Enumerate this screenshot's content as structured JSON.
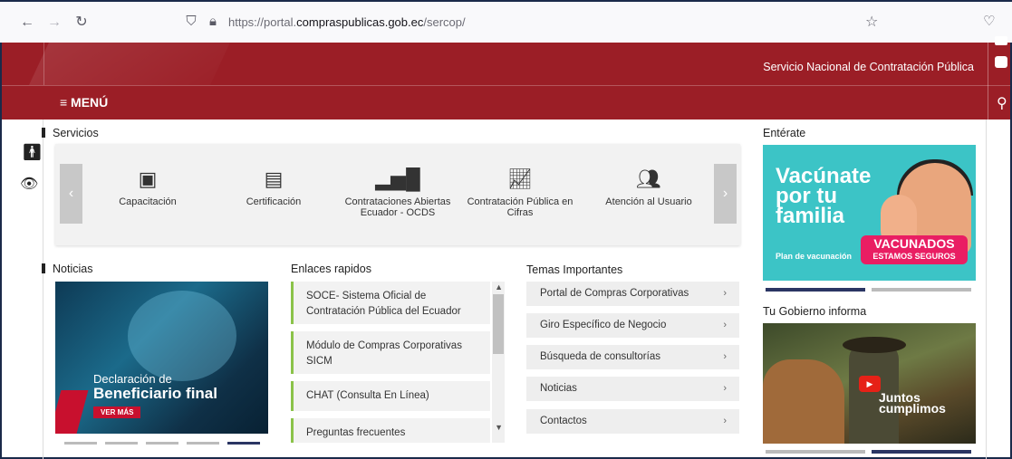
{
  "browser": {
    "url_prefix": "https://portal.",
    "url_domain": "compraspublicas.gob.ec",
    "url_path": "/sercop/"
  },
  "header": {
    "site_name": "Servicio Nacional de Contratación Pública",
    "menu_label": "≡ MENÚ"
  },
  "services": {
    "title": "Servicios",
    "items": [
      {
        "label": "Capacitación",
        "icon": "book-icon"
      },
      {
        "label": "Certificación",
        "icon": "certificate-icon"
      },
      {
        "label": "Contrataciones Abiertas Ecuador - OCDS",
        "icon": "bar-chart-icon"
      },
      {
        "label": "Contratación Pública en Cifras",
        "icon": "line-chart-icon"
      },
      {
        "label": "Atención al Usuario",
        "icon": "users-icon"
      }
    ]
  },
  "news": {
    "title": "Noticias",
    "slide_line1": "Declaración de",
    "slide_line2": "Beneficiario final",
    "slide_button": "VER MÁS"
  },
  "links": {
    "title": "Enlaces rapidos",
    "items": [
      "SOCE- Sistema Oficial de Contratación Pública del Ecuador",
      "Módulo de Compras Corporativas SICM",
      "CHAT (Consulta En Línea)",
      "Preguntas frecuentes"
    ]
  },
  "topics": {
    "title": "Temas Importantes",
    "items": [
      "Portal de Compras Corporativas",
      "Giro Específico de Negocio",
      "Búsqueda de consultorías",
      "Noticias",
      "Contactos"
    ]
  },
  "right": {
    "enterate_title": "Entérate",
    "banner_line1": "Vacúnate",
    "banner_line2": "por tu",
    "banner_line3": "familia",
    "banner_badge1": "VACUNADOS",
    "banner_badge2": "ESTAMOS SEGUROS",
    "banner_plan": "Plan de vacunación",
    "gov_title": "Tu Gobierno informa",
    "video_caption1": "Juntos",
    "video_caption2": "cumplimos"
  },
  "colors": {
    "brand_red": "#9b1e26",
    "active_indicator": "#2a3563",
    "link_accent": "#8bc34a"
  }
}
